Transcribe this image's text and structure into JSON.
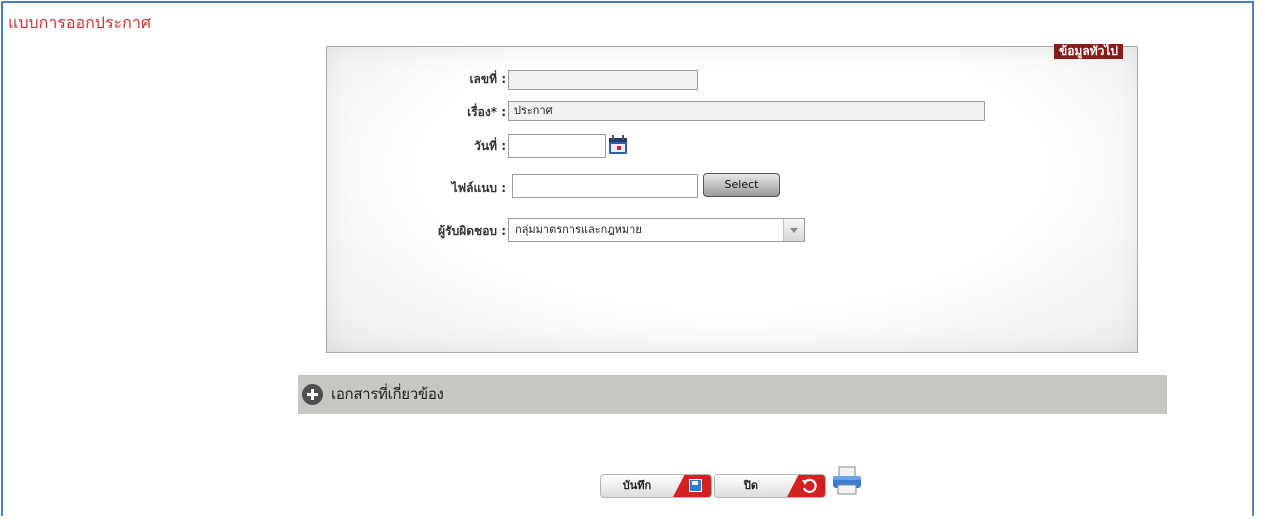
{
  "page": {
    "title": "แบบการออกประกาศ"
  },
  "panel": {
    "legend": "ข้อมูลทั่วไป"
  },
  "form": {
    "number": {
      "label": "เลขที่ :",
      "value": ""
    },
    "subject": {
      "label": "เรื่อง* :",
      "value": "ประกาศ"
    },
    "date": {
      "label": "วันที่ :",
      "value": ""
    },
    "attachment": {
      "label": "ไฟล์แนบ :",
      "value": "",
      "button_label": "Select"
    },
    "responsible": {
      "label": "ผู้รับผิดชอบ :",
      "selected": "กลุ่มมาตรการและกฎหมาย"
    }
  },
  "related_docs": {
    "label": "เอกสารที่เกี่ยวข้อง"
  },
  "actions": {
    "save_label": "บันทึก",
    "close_label": "ปิด"
  },
  "icons": {
    "calendar": "calendar-icon",
    "plus": "plus-circle-icon",
    "save": "save-icon",
    "undo": "undo-icon",
    "print": "printer-icon"
  },
  "colors": {
    "title": "#d03030",
    "frame_border": "#4a7fc0",
    "legend_bg": "#8b1a1a",
    "section_bar": "#c8c6c2",
    "action_red": "#d42020"
  }
}
